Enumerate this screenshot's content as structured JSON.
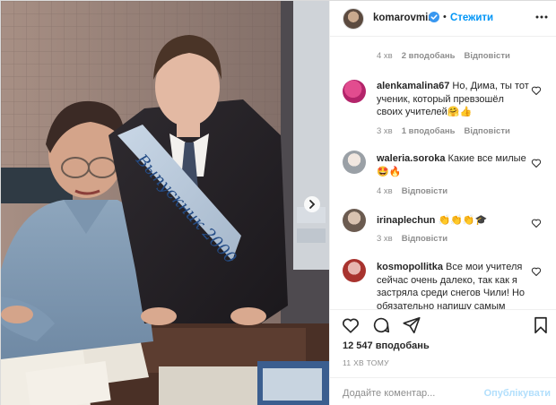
{
  "post": {
    "username": "komarovmir",
    "follow_label": "Стежити",
    "likes": "12 547 вподобань",
    "time": "11 ХВ ТОМУ",
    "comment_placeholder": "Додайте коментар...",
    "post_label": "Опублікувати"
  },
  "top_meta": {
    "time": "4 хв",
    "likes": "2 вподобань",
    "reply": "Відповісти"
  },
  "comments": [
    {
      "username": "alenkamalina67",
      "text": "Но, Дима, ты тот ученик, который превзошёл своих учителей🤗👍",
      "time": "3 хв",
      "likes": "1 вподобань",
      "reply": "Відповісти"
    },
    {
      "username": "waleria.soroka",
      "text": "Какие все милые 🤩🔥",
      "time": "4 хв",
      "reply": "Відповісти"
    },
    {
      "username": "irinaplechun",
      "text": "👏👏👏🎓",
      "time": "3 хв",
      "reply": "Відповісти"
    },
    {
      "username": "kosmopollitka",
      "text": "Все мои учителя сейчас очень далеко, так как я застряла среди снегов Чили! Но обязательно напишу самым",
      "time": "",
      "reply": ""
    }
  ],
  "photo": {
    "sash_text": "Выпускник 2000"
  },
  "colors": {
    "accent": "#0095f6",
    "accent_disabled": "#b2dffc",
    "text": "#262626",
    "muted": "#8e8e8e",
    "border": "#efefef"
  },
  "icons": [
    "verified-icon",
    "more-icon",
    "heart-icon",
    "comment-icon",
    "share-icon",
    "bookmark-icon",
    "chevron-right-icon"
  ]
}
